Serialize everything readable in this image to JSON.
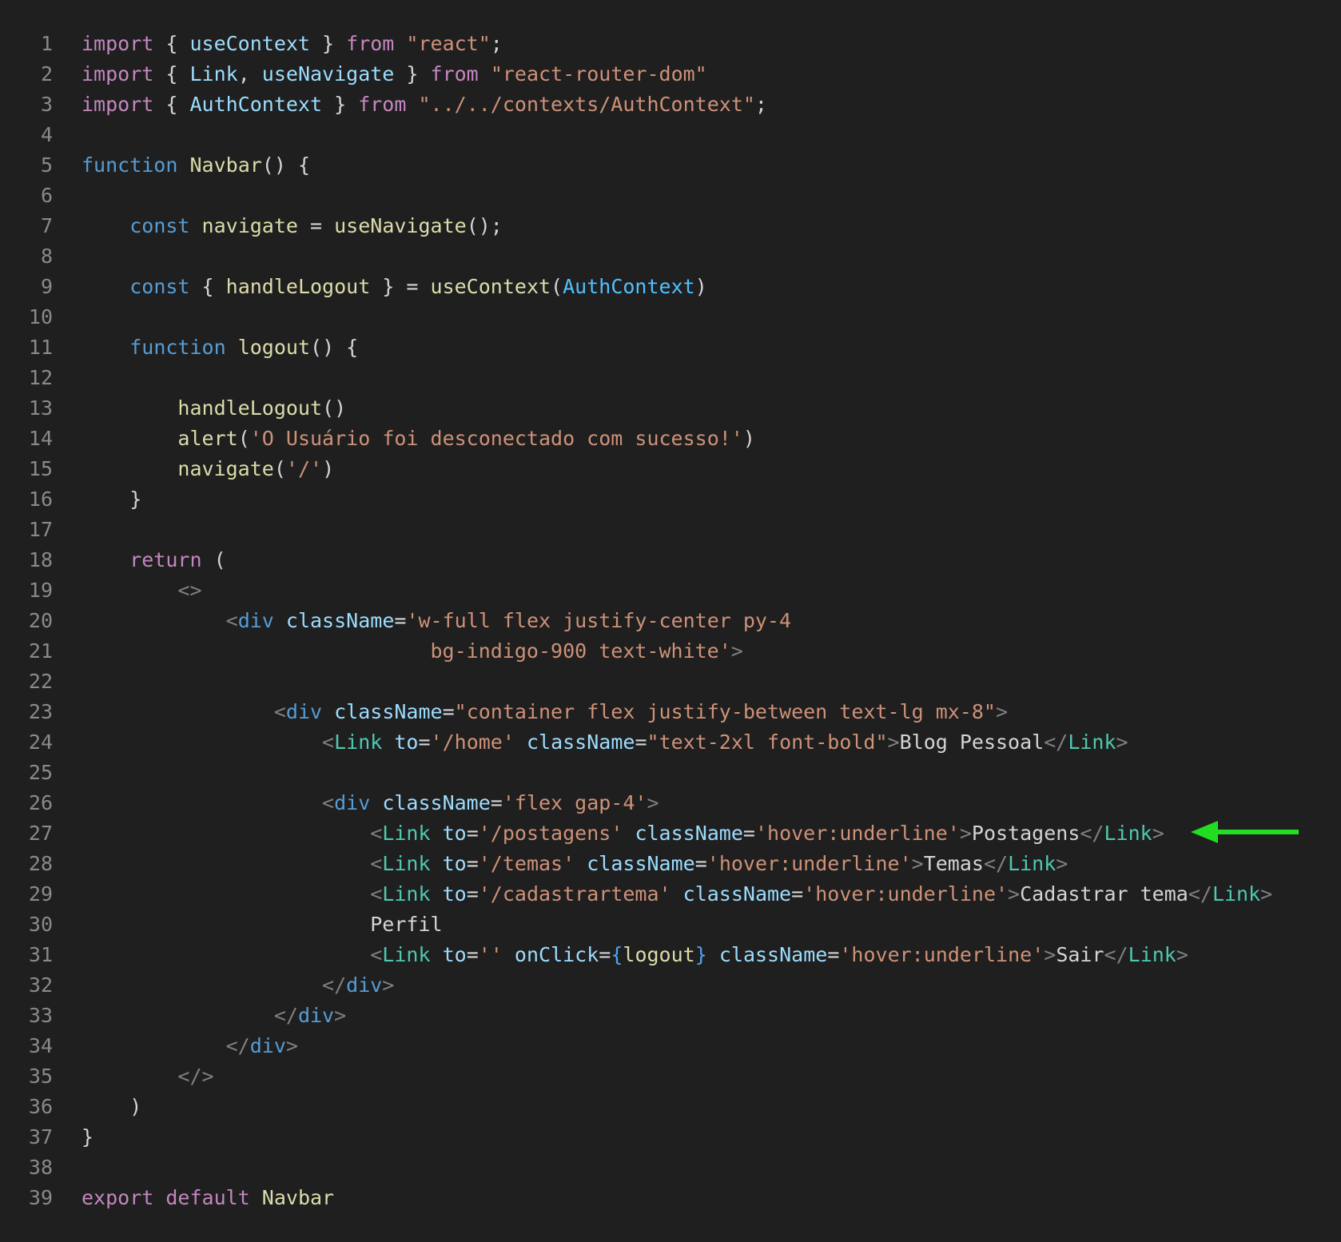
{
  "editor": {
    "colors": {
      "background": "#1f1f1f",
      "line_number": "#8a8a8a",
      "keyword": "#c586c0",
      "declaration": "#569cd6",
      "function": "#dcdcaa",
      "variable": "#9cdcfe",
      "string": "#ce9178",
      "component": "#4ec9b0",
      "constant": "#4fc1ff",
      "punctuation": "#808080",
      "annotation_arrow": "#22dd22"
    },
    "lines": [
      {
        "number": "1",
        "tokens": [
          {
            "t": "import",
            "c": "kw"
          },
          {
            "t": " { ",
            "c": "text"
          },
          {
            "t": "useContext",
            "c": "var"
          },
          {
            "t": " } ",
            "c": "text"
          },
          {
            "t": "from",
            "c": "kw"
          },
          {
            "t": " ",
            "c": "text"
          },
          {
            "t": "\"react\"",
            "c": "str"
          },
          {
            "t": ";",
            "c": "text"
          }
        ]
      },
      {
        "number": "2",
        "tokens": [
          {
            "t": "import",
            "c": "kw"
          },
          {
            "t": " { ",
            "c": "text"
          },
          {
            "t": "Link",
            "c": "var"
          },
          {
            "t": ", ",
            "c": "text"
          },
          {
            "t": "useNavigate",
            "c": "var"
          },
          {
            "t": " } ",
            "c": "text"
          },
          {
            "t": "from",
            "c": "kw"
          },
          {
            "t": " ",
            "c": "text"
          },
          {
            "t": "\"react-router-dom\"",
            "c": "str"
          }
        ]
      },
      {
        "number": "3",
        "tokens": [
          {
            "t": "import",
            "c": "kw"
          },
          {
            "t": " { ",
            "c": "text"
          },
          {
            "t": "AuthContext",
            "c": "var"
          },
          {
            "t": " } ",
            "c": "text"
          },
          {
            "t": "from",
            "c": "kw"
          },
          {
            "t": " ",
            "c": "text"
          },
          {
            "t": "\"../../contexts/AuthContext\"",
            "c": "str"
          },
          {
            "t": ";",
            "c": "text"
          }
        ]
      },
      {
        "number": "4",
        "tokens": []
      },
      {
        "number": "5",
        "tokens": [
          {
            "t": "function",
            "c": "decl"
          },
          {
            "t": " ",
            "c": "text"
          },
          {
            "t": "Navbar",
            "c": "fn"
          },
          {
            "t": "() {",
            "c": "text"
          }
        ]
      },
      {
        "number": "6",
        "tokens": []
      },
      {
        "number": "7",
        "tokens": [
          {
            "t": "    ",
            "c": "text"
          },
          {
            "t": "const",
            "c": "decl"
          },
          {
            "t": " ",
            "c": "text"
          },
          {
            "t": "navigate",
            "c": "fn"
          },
          {
            "t": " = ",
            "c": "text"
          },
          {
            "t": "useNavigate",
            "c": "fn"
          },
          {
            "t": "();",
            "c": "text"
          }
        ]
      },
      {
        "number": "8",
        "tokens": []
      },
      {
        "number": "9",
        "tokens": [
          {
            "t": "    ",
            "c": "text"
          },
          {
            "t": "const",
            "c": "decl"
          },
          {
            "t": " { ",
            "c": "text"
          },
          {
            "t": "handleLogout",
            "c": "fn"
          },
          {
            "t": " } = ",
            "c": "text"
          },
          {
            "t": "useContext",
            "c": "fn"
          },
          {
            "t": "(",
            "c": "text"
          },
          {
            "t": "AuthContext",
            "c": "const"
          },
          {
            "t": ")",
            "c": "text"
          }
        ]
      },
      {
        "number": "10",
        "tokens": []
      },
      {
        "number": "11",
        "tokens": [
          {
            "t": "    ",
            "c": "text"
          },
          {
            "t": "function",
            "c": "decl"
          },
          {
            "t": " ",
            "c": "text"
          },
          {
            "t": "logout",
            "c": "fn"
          },
          {
            "t": "() {",
            "c": "text"
          }
        ]
      },
      {
        "number": "12",
        "tokens": []
      },
      {
        "number": "13",
        "tokens": [
          {
            "t": "        ",
            "c": "text"
          },
          {
            "t": "handleLogout",
            "c": "fn"
          },
          {
            "t": "()",
            "c": "text"
          }
        ]
      },
      {
        "number": "14",
        "tokens": [
          {
            "t": "        ",
            "c": "text"
          },
          {
            "t": "alert",
            "c": "fn"
          },
          {
            "t": "(",
            "c": "text"
          },
          {
            "t": "'O Usuário foi desconectado com sucesso!'",
            "c": "str"
          },
          {
            "t": ")",
            "c": "text"
          }
        ]
      },
      {
        "number": "15",
        "tokens": [
          {
            "t": "        ",
            "c": "text"
          },
          {
            "t": "navigate",
            "c": "fn"
          },
          {
            "t": "(",
            "c": "text"
          },
          {
            "t": "'/'",
            "c": "str"
          },
          {
            "t": ")",
            "c": "text"
          }
        ]
      },
      {
        "number": "16",
        "tokens": [
          {
            "t": "    }",
            "c": "text"
          }
        ]
      },
      {
        "number": "17",
        "tokens": []
      },
      {
        "number": "18",
        "tokens": [
          {
            "t": "    ",
            "c": "text"
          },
          {
            "t": "return",
            "c": "kw"
          },
          {
            "t": " (",
            "c": "text"
          }
        ]
      },
      {
        "number": "19",
        "tokens": [
          {
            "t": "        ",
            "c": "text"
          },
          {
            "t": "<>",
            "c": "punct"
          }
        ]
      },
      {
        "number": "20",
        "tokens": [
          {
            "t": "            ",
            "c": "text"
          },
          {
            "t": "<",
            "c": "punct"
          },
          {
            "t": "div",
            "c": "decl"
          },
          {
            "t": " ",
            "c": "text"
          },
          {
            "t": "className",
            "c": "var"
          },
          {
            "t": "=",
            "c": "text"
          },
          {
            "t": "'w-full flex justify-center py-4",
            "c": "str"
          }
        ]
      },
      {
        "number": "21",
        "tokens": [
          {
            "t": "                             ",
            "c": "text"
          },
          {
            "t": "bg-indigo-900 text-white'",
            "c": "str"
          },
          {
            "t": ">",
            "c": "punct"
          }
        ]
      },
      {
        "number": "22",
        "tokens": []
      },
      {
        "number": "23",
        "tokens": [
          {
            "t": "                ",
            "c": "text"
          },
          {
            "t": "<",
            "c": "punct"
          },
          {
            "t": "div",
            "c": "decl"
          },
          {
            "t": " ",
            "c": "text"
          },
          {
            "t": "className",
            "c": "var"
          },
          {
            "t": "=",
            "c": "text"
          },
          {
            "t": "\"container flex justify-between text-lg mx-8\"",
            "c": "str"
          },
          {
            "t": ">",
            "c": "punct"
          }
        ]
      },
      {
        "number": "24",
        "tokens": [
          {
            "t": "                    ",
            "c": "text"
          },
          {
            "t": "<",
            "c": "punct"
          },
          {
            "t": "Link",
            "c": "type"
          },
          {
            "t": " ",
            "c": "text"
          },
          {
            "t": "to",
            "c": "var"
          },
          {
            "t": "=",
            "c": "text"
          },
          {
            "t": "'/home'",
            "c": "str"
          },
          {
            "t": " ",
            "c": "text"
          },
          {
            "t": "className",
            "c": "var"
          },
          {
            "t": "=",
            "c": "text"
          },
          {
            "t": "\"text-2xl font-bold\"",
            "c": "str"
          },
          {
            "t": ">",
            "c": "punct"
          },
          {
            "t": "Blog Pessoal",
            "c": "text"
          },
          {
            "t": "</",
            "c": "punct"
          },
          {
            "t": "Link",
            "c": "type"
          },
          {
            "t": ">",
            "c": "punct"
          }
        ]
      },
      {
        "number": "25",
        "tokens": []
      },
      {
        "number": "26",
        "tokens": [
          {
            "t": "                    ",
            "c": "text"
          },
          {
            "t": "<",
            "c": "punct"
          },
          {
            "t": "div",
            "c": "decl"
          },
          {
            "t": " ",
            "c": "text"
          },
          {
            "t": "className",
            "c": "var"
          },
          {
            "t": "=",
            "c": "text"
          },
          {
            "t": "'flex gap-4'",
            "c": "str"
          },
          {
            "t": ">",
            "c": "punct"
          }
        ]
      },
      {
        "number": "27",
        "tokens": [
          {
            "t": "                        ",
            "c": "text"
          },
          {
            "t": "<",
            "c": "punct"
          },
          {
            "t": "Link",
            "c": "type"
          },
          {
            "t": " ",
            "c": "text"
          },
          {
            "t": "to",
            "c": "var"
          },
          {
            "t": "=",
            "c": "text"
          },
          {
            "t": "'/postagens'",
            "c": "str"
          },
          {
            "t": " ",
            "c": "text"
          },
          {
            "t": "className",
            "c": "var"
          },
          {
            "t": "=",
            "c": "text"
          },
          {
            "t": "'hover:underline'",
            "c": "str"
          },
          {
            "t": ">",
            "c": "punct"
          },
          {
            "t": "Postagens",
            "c": "text"
          },
          {
            "t": "</",
            "c": "punct"
          },
          {
            "t": "Link",
            "c": "type"
          },
          {
            "t": ">",
            "c": "punct"
          }
        ]
      },
      {
        "number": "28",
        "tokens": [
          {
            "t": "                        ",
            "c": "text"
          },
          {
            "t": "<",
            "c": "punct"
          },
          {
            "t": "Link",
            "c": "type"
          },
          {
            "t": " ",
            "c": "text"
          },
          {
            "t": "to",
            "c": "var"
          },
          {
            "t": "=",
            "c": "text"
          },
          {
            "t": "'/temas'",
            "c": "str"
          },
          {
            "t": " ",
            "c": "text"
          },
          {
            "t": "className",
            "c": "var"
          },
          {
            "t": "=",
            "c": "text"
          },
          {
            "t": "'hover:underline'",
            "c": "str"
          },
          {
            "t": ">",
            "c": "punct"
          },
          {
            "t": "Temas",
            "c": "text"
          },
          {
            "t": "</",
            "c": "punct"
          },
          {
            "t": "Link",
            "c": "type"
          },
          {
            "t": ">",
            "c": "punct"
          }
        ]
      },
      {
        "number": "29",
        "tokens": [
          {
            "t": "                        ",
            "c": "text"
          },
          {
            "t": "<",
            "c": "punct"
          },
          {
            "t": "Link",
            "c": "type"
          },
          {
            "t": " ",
            "c": "text"
          },
          {
            "t": "to",
            "c": "var"
          },
          {
            "t": "=",
            "c": "text"
          },
          {
            "t": "'/cadastrartema'",
            "c": "str"
          },
          {
            "t": " ",
            "c": "text"
          },
          {
            "t": "className",
            "c": "var"
          },
          {
            "t": "=",
            "c": "text"
          },
          {
            "t": "'hover:underline'",
            "c": "str"
          },
          {
            "t": ">",
            "c": "punct"
          },
          {
            "t": "Cadastrar tema",
            "c": "text"
          },
          {
            "t": "</",
            "c": "punct"
          },
          {
            "t": "Link",
            "c": "type"
          },
          {
            "t": ">",
            "c": "punct"
          }
        ]
      },
      {
        "number": "30",
        "tokens": [
          {
            "t": "                        ",
            "c": "text"
          },
          {
            "t": "Perfil",
            "c": "text"
          }
        ]
      },
      {
        "number": "31",
        "tokens": [
          {
            "t": "                        ",
            "c": "text"
          },
          {
            "t": "<",
            "c": "punct"
          },
          {
            "t": "Link",
            "c": "type"
          },
          {
            "t": " ",
            "c": "text"
          },
          {
            "t": "to",
            "c": "var"
          },
          {
            "t": "=",
            "c": "text"
          },
          {
            "t": "''",
            "c": "str"
          },
          {
            "t": " ",
            "c": "text"
          },
          {
            "t": "onClick",
            "c": "var"
          },
          {
            "t": "=",
            "c": "text"
          },
          {
            "t": "{",
            "c": "brace"
          },
          {
            "t": "logout",
            "c": "fn"
          },
          {
            "t": "}",
            "c": "brace"
          },
          {
            "t": " ",
            "c": "text"
          },
          {
            "t": "className",
            "c": "var"
          },
          {
            "t": "=",
            "c": "text"
          },
          {
            "t": "'hover:underline'",
            "c": "str"
          },
          {
            "t": ">",
            "c": "punct"
          },
          {
            "t": "Sair",
            "c": "text"
          },
          {
            "t": "</",
            "c": "punct"
          },
          {
            "t": "Link",
            "c": "type"
          },
          {
            "t": ">",
            "c": "punct"
          }
        ]
      },
      {
        "number": "32",
        "tokens": [
          {
            "t": "                    ",
            "c": "text"
          },
          {
            "t": "</",
            "c": "punct"
          },
          {
            "t": "div",
            "c": "decl"
          },
          {
            "t": ">",
            "c": "punct"
          }
        ]
      },
      {
        "number": "33",
        "tokens": [
          {
            "t": "                ",
            "c": "text"
          },
          {
            "t": "</",
            "c": "punct"
          },
          {
            "t": "div",
            "c": "decl"
          },
          {
            "t": ">",
            "c": "punct"
          }
        ]
      },
      {
        "number": "34",
        "tokens": [
          {
            "t": "            ",
            "c": "text"
          },
          {
            "t": "</",
            "c": "punct"
          },
          {
            "t": "div",
            "c": "decl"
          },
          {
            "t": ">",
            "c": "punct"
          }
        ]
      },
      {
        "number": "35",
        "tokens": [
          {
            "t": "        ",
            "c": "text"
          },
          {
            "t": "</>",
            "c": "punct"
          }
        ]
      },
      {
        "number": "36",
        "tokens": [
          {
            "t": "    )",
            "c": "text"
          }
        ]
      },
      {
        "number": "37",
        "tokens": [
          {
            "t": "}",
            "c": "text"
          }
        ]
      },
      {
        "number": "38",
        "tokens": []
      },
      {
        "number": "39",
        "tokens": [
          {
            "t": "export",
            "c": "kw"
          },
          {
            "t": " ",
            "c": "text"
          },
          {
            "t": "default",
            "c": "kw"
          },
          {
            "t": " ",
            "c": "text"
          },
          {
            "t": "Navbar",
            "c": "fn"
          }
        ]
      }
    ],
    "annotation": {
      "icon": "arrow-left-icon",
      "points_to_line": "27"
    }
  }
}
